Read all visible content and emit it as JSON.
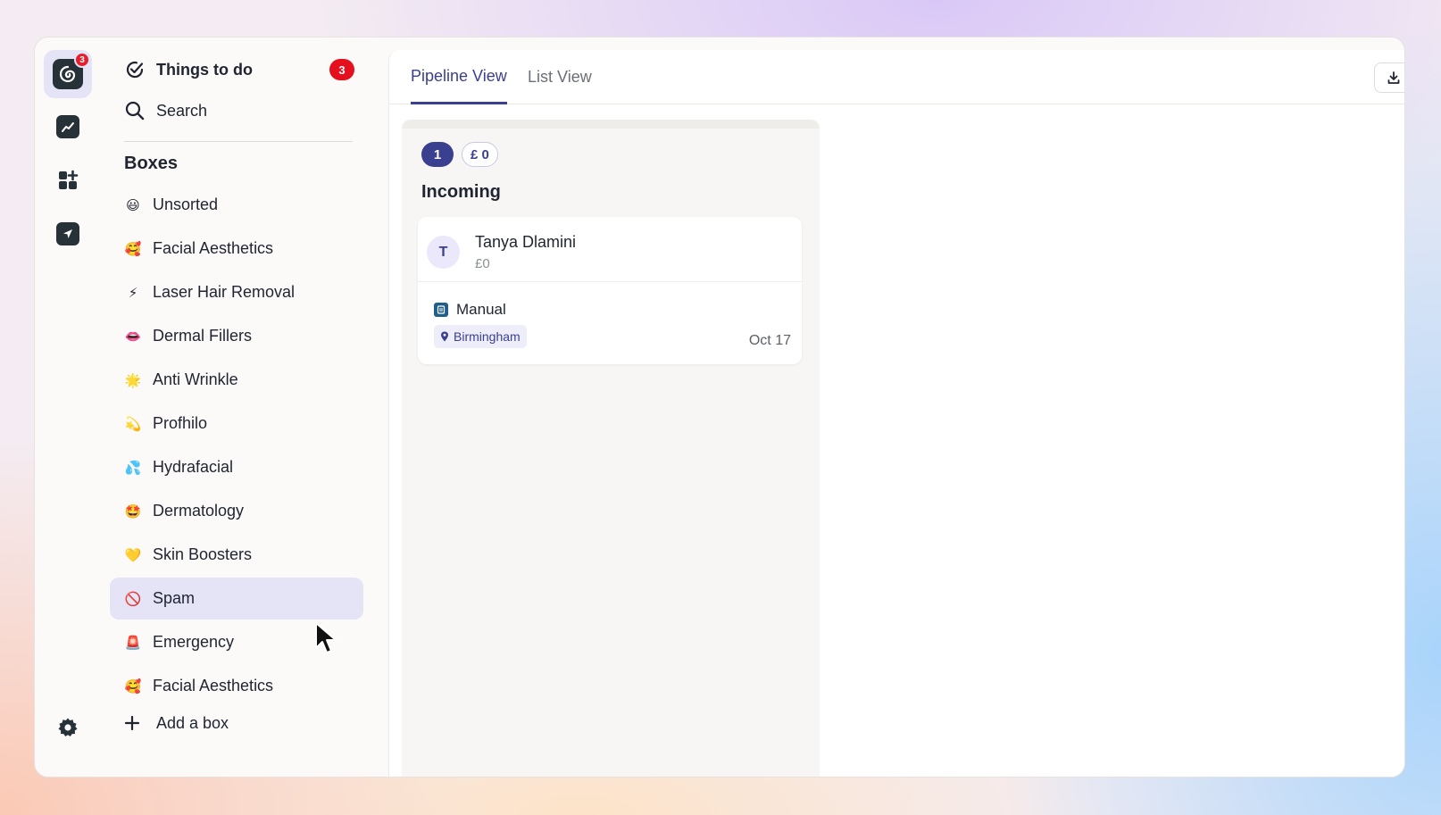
{
  "rail": {
    "logo_badge": "3",
    "icons": [
      "app-logo-icon",
      "chart-icon",
      "apps-add-icon",
      "send-icon",
      "settings-icon"
    ]
  },
  "sidebar": {
    "things_to_do": {
      "label": "Things to do",
      "badge": "3"
    },
    "search": {
      "label": "Search"
    },
    "boxes_title": "Boxes",
    "boxes": [
      {
        "emoji": "😃",
        "label": "Unsorted"
      },
      {
        "emoji": "🥰",
        "label": "Facial Aesthetics"
      },
      {
        "emoji": "⚡",
        "label": "Laser Hair Removal"
      },
      {
        "emoji": "👄",
        "label": "Dermal Fillers"
      },
      {
        "emoji": "🌟",
        "label": "Anti Wrinkle"
      },
      {
        "emoji": "💫",
        "label": "Profhilo"
      },
      {
        "emoji": "💦",
        "label": "Hydrafacial"
      },
      {
        "emoji": "🤩",
        "label": "Dermatology"
      },
      {
        "emoji": "💛",
        "label": "Skin Boosters"
      },
      {
        "emoji": "🚫",
        "label": "Spam"
      },
      {
        "emoji": "🚨",
        "label": "Emergency"
      },
      {
        "emoji": "🥰",
        "label": "Facial Aesthetics"
      }
    ],
    "active_box": "Spam",
    "add_box_label": "Add a box"
  },
  "main": {
    "tabs": [
      {
        "label": "Pipeline View",
        "active": true
      },
      {
        "label": "List View",
        "active": false
      }
    ],
    "column": {
      "count": "1",
      "amount": "£ 0",
      "title": "Incoming",
      "cards": [
        {
          "initial": "T",
          "name": "Tanya Dlamini",
          "amount": "£0",
          "source": "Manual",
          "location": "Birmingham",
          "date": "Oct 17"
        }
      ]
    }
  },
  "colors": {
    "accent": "#3a3f8f",
    "badge_red": "#e5101e",
    "active_bg": "#e4e4f6"
  }
}
